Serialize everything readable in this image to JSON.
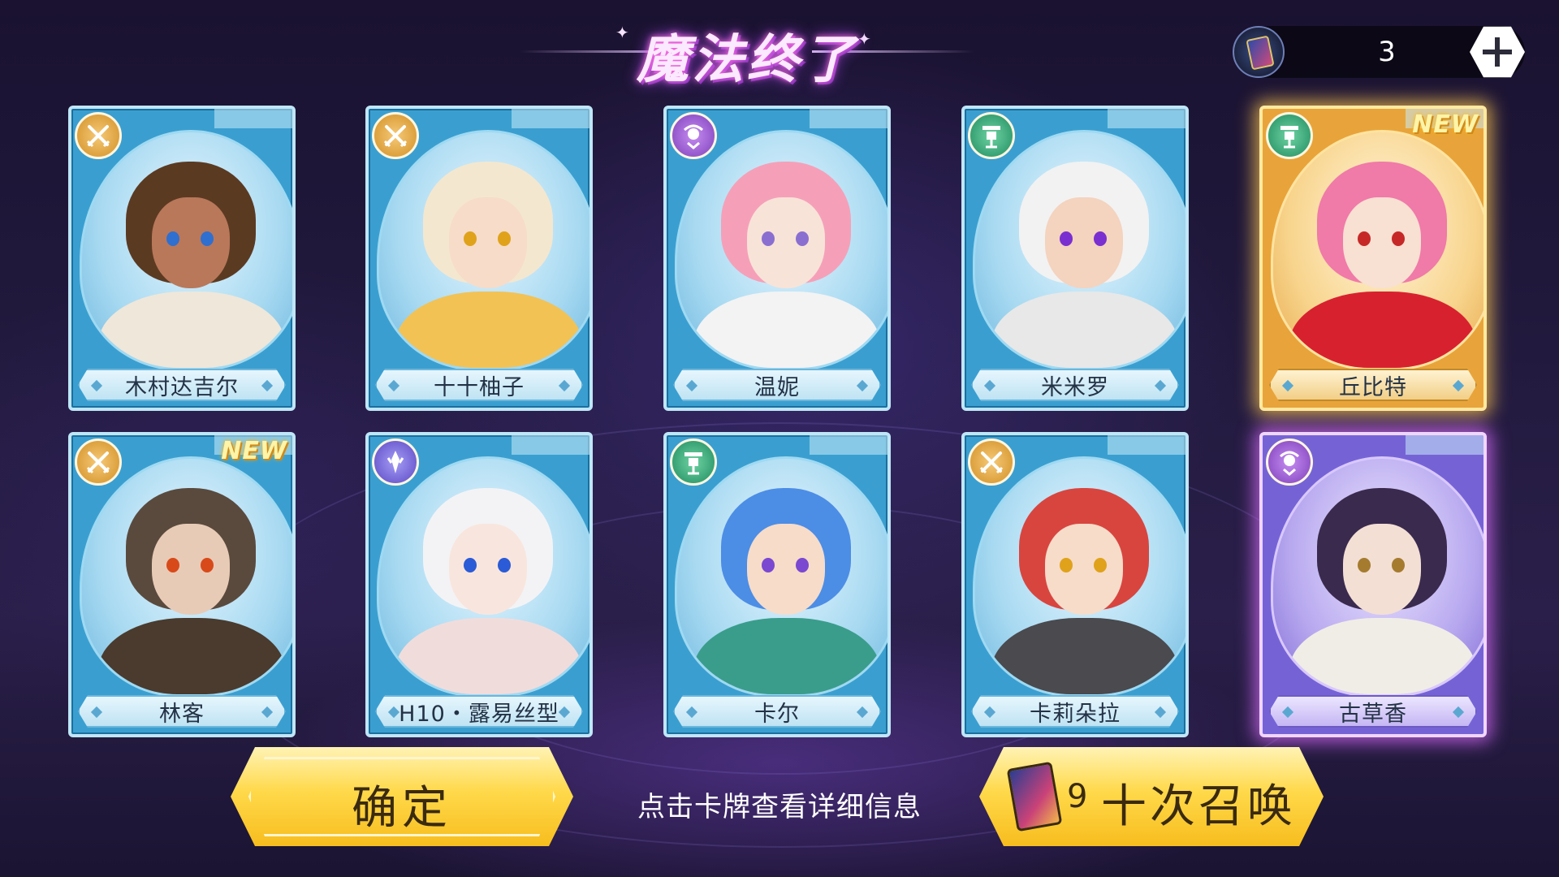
{
  "title": "魔法终了",
  "ticket": {
    "icon": "summon-card-icon",
    "count": "3",
    "add_icon": "plus-icon"
  },
  "cards": [
    {
      "name": "木村达吉尔",
      "type": "fighter",
      "type_icon": "crossed-swords-icon",
      "rarity": "blue",
      "is_new": false
    },
    {
      "name": "十十柚子",
      "type": "fighter",
      "type_icon": "crossed-swords-icon",
      "rarity": "blue",
      "is_new": false
    },
    {
      "name": "温妮",
      "type": "mage",
      "type_icon": "magic-orb-icon",
      "rarity": "blue",
      "is_new": false
    },
    {
      "name": "米米罗",
      "type": "support",
      "type_icon": "totem-icon",
      "rarity": "blue",
      "is_new": false
    },
    {
      "name": "丘比特",
      "type": "support",
      "type_icon": "totem-icon",
      "rarity": "gold",
      "is_new": true
    },
    {
      "name": "林客",
      "type": "fighter",
      "type_icon": "crossed-swords-icon",
      "rarity": "blue",
      "is_new": true
    },
    {
      "name": "H10・露易丝型",
      "type": "archer",
      "type_icon": "arrow-blade-icon",
      "rarity": "blue",
      "is_new": false
    },
    {
      "name": "卡尔",
      "type": "support",
      "type_icon": "totem-icon",
      "rarity": "blue",
      "is_new": false
    },
    {
      "name": "卡莉朵拉",
      "type": "fighter",
      "type_icon": "crossed-swords-icon",
      "rarity": "blue",
      "is_new": false
    },
    {
      "name": "古草香",
      "type": "mage",
      "type_icon": "magic-orb-icon",
      "rarity": "purple",
      "is_new": false
    }
  ],
  "new_label": "NEW",
  "confirm_label": "确定",
  "hint": "点击卡牌查看详细信息",
  "summon": {
    "cost": "9",
    "label": "十次召唤",
    "icon": "summon-card-icon"
  },
  "colors": {
    "blue_card": "#3a9fd0",
    "gold_card": "#e8a43a",
    "purple_card": "#7563d6",
    "button_gold": "#ffd94a"
  }
}
